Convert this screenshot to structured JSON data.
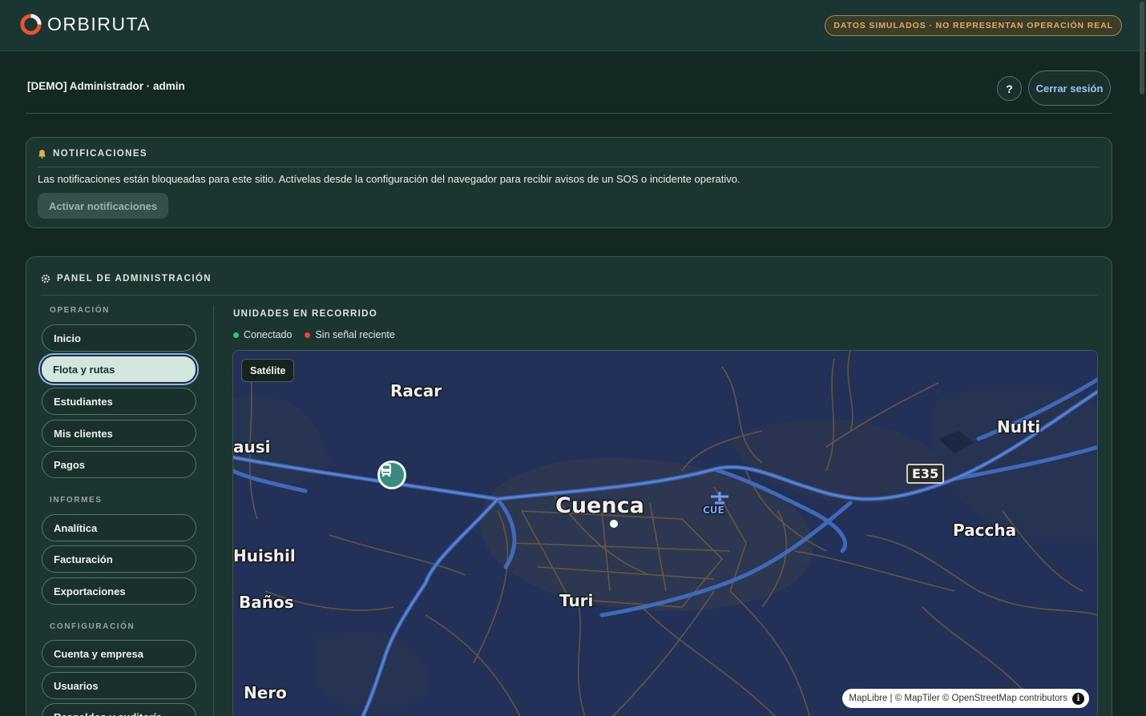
{
  "brand": {
    "name": "ORBIRUTA"
  },
  "banner": {
    "simulated": "DATOS SIMULADOS · NO REPRESENTAN OPERACIÓN REAL"
  },
  "user": {
    "label": "[DEMO] Administrador · admin"
  },
  "header": {
    "help_label": "?",
    "logout_label": "Cerrar sesión"
  },
  "notifications": {
    "title": "NOTIFICACIONES",
    "message": "Las notificaciones están bloqueadas para este sitio. Actívelas desde la configuración del navegador para recibir avisos de un SOS o incidente operativo.",
    "button": "Activar notificaciones"
  },
  "admin": {
    "title": "PANEL DE ADMINISTRACIÓN",
    "sections": [
      {
        "label": "OPERACIÓN",
        "items": [
          "Inicio",
          "Flota y rutas",
          "Estudiantes",
          "Mis clientes",
          "Pagos"
        ]
      },
      {
        "label": "INFORMES",
        "items": [
          "Analítica",
          "Facturación",
          "Exportaciones"
        ]
      },
      {
        "label": "CONFIGURACIÓN",
        "items": [
          "Cuenta y empresa",
          "Usuarios",
          "Respaldos y auditoría"
        ]
      }
    ],
    "active_item": "Flota y rutas"
  },
  "units": {
    "title": "UNIDADES EN RECORRIDO",
    "legend": [
      {
        "label": "Conectado",
        "color": "#35c46a"
      },
      {
        "label": "Sin señal reciente",
        "color": "#e04848"
      }
    ]
  },
  "map": {
    "toggle": "Satélite",
    "attribution": "MapLibre | © MapTiler © OpenStreetMap contributors",
    "info": "i",
    "places": {
      "racar": "Racar",
      "nulti": "Nulti",
      "ausi": "ausi",
      "cuenca": "Cuenca",
      "cue": "CUE",
      "paccha": "Paccha",
      "huishil": "Huishil",
      "banos": "Baños",
      "turi": "Turi",
      "nero": "Nero"
    },
    "highway": "E35"
  },
  "colors": {
    "accent": "#3b8c7f",
    "warning": "#e1ad5b",
    "link": "#9fc4ee"
  }
}
